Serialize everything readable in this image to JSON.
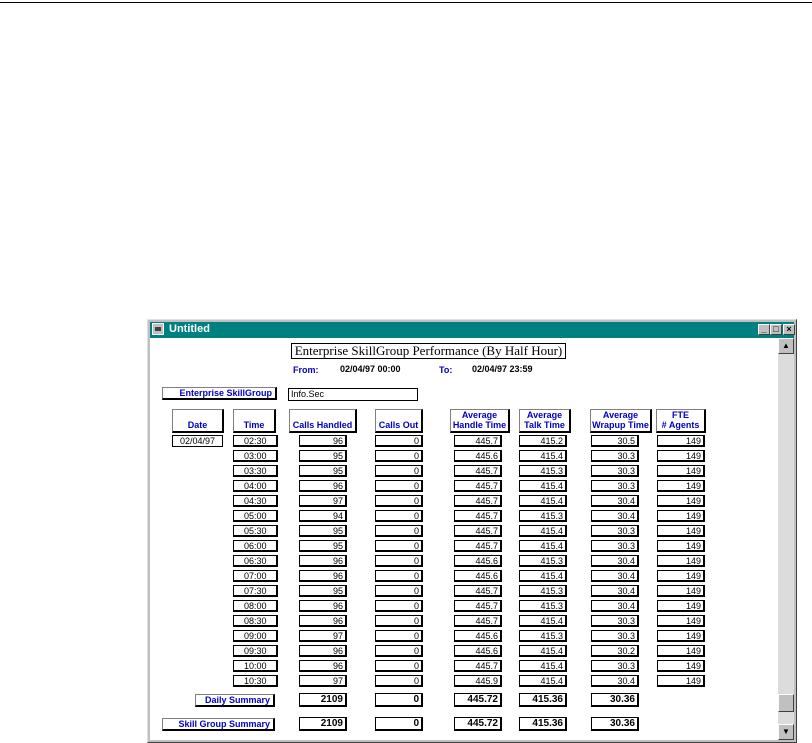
{
  "window": {
    "title": "Untitled",
    "minimize_glyph": "_",
    "maximize_glyph": "□",
    "close_glyph": "×"
  },
  "report": {
    "title": "Enterprise SkillGroup Performance (By Half Hour)",
    "from_label": "From:",
    "from_value": "02/04/97 00:00",
    "to_label": "To:",
    "to_value": "02/04/97 23:59",
    "skill_group_label": "Enterprise SkillGroup",
    "skill_group_value": "Info.Sec",
    "date": "02/04/97"
  },
  "columns": [
    "Date",
    "Time",
    "Calls Handled",
    "Calls Out",
    "Average\nHandle Time",
    "Average\nTalk Time",
    "Average\nWrapup Time",
    "FTE\n# Agents"
  ],
  "rows": [
    [
      "02:30",
      "96",
      "0",
      "445.7",
      "415.2",
      "30.5",
      "149"
    ],
    [
      "03:00",
      "95",
      "0",
      "445.6",
      "415.4",
      "30.3",
      "149"
    ],
    [
      "03:30",
      "95",
      "0",
      "445.7",
      "415.3",
      "30.3",
      "149"
    ],
    [
      "04:00",
      "96",
      "0",
      "445.7",
      "415.4",
      "30.3",
      "149"
    ],
    [
      "04:30",
      "97",
      "0",
      "445.7",
      "415.4",
      "30.4",
      "149"
    ],
    [
      "05:00",
      "94",
      "0",
      "445.7",
      "415.3",
      "30.4",
      "149"
    ],
    [
      "05:30",
      "95",
      "0",
      "445.7",
      "415.4",
      "30.3",
      "149"
    ],
    [
      "06:00",
      "95",
      "0",
      "445.7",
      "415.4",
      "30.3",
      "149"
    ],
    [
      "06:30",
      "96",
      "0",
      "445.6",
      "415.3",
      "30.4",
      "149"
    ],
    [
      "07:00",
      "96",
      "0",
      "445.6",
      "415.4",
      "30.4",
      "149"
    ],
    [
      "07:30",
      "95",
      "0",
      "445.7",
      "415.3",
      "30.4",
      "149"
    ],
    [
      "08:00",
      "96",
      "0",
      "445.7",
      "415.3",
      "30.4",
      "149"
    ],
    [
      "08:30",
      "96",
      "0",
      "445.7",
      "415.4",
      "30.3",
      "149"
    ],
    [
      "09:00",
      "97",
      "0",
      "445.6",
      "415.3",
      "30.3",
      "149"
    ],
    [
      "09:30",
      "96",
      "0",
      "445.6",
      "415.4",
      "30.2",
      "149"
    ],
    [
      "10:00",
      "96",
      "0",
      "445.7",
      "415.4",
      "30.3",
      "149"
    ],
    [
      "10:30",
      "97",
      "0",
      "445.9",
      "415.4",
      "30.4",
      "149"
    ]
  ],
  "daily_summary": {
    "label": "Daily Summary",
    "values": [
      "2109",
      "0",
      "445.72",
      "415.36",
      "30.36"
    ]
  },
  "skill_group_summary": {
    "label": "Skill Group Summary",
    "values": [
      "2109",
      "0",
      "445.72",
      "415.36",
      "30.36"
    ]
  },
  "scrollbar": {
    "up_glyph": "▲",
    "down_glyph": "▼"
  },
  "colors": {
    "titlebar": "#008080",
    "label_text": "#0000c0"
  }
}
